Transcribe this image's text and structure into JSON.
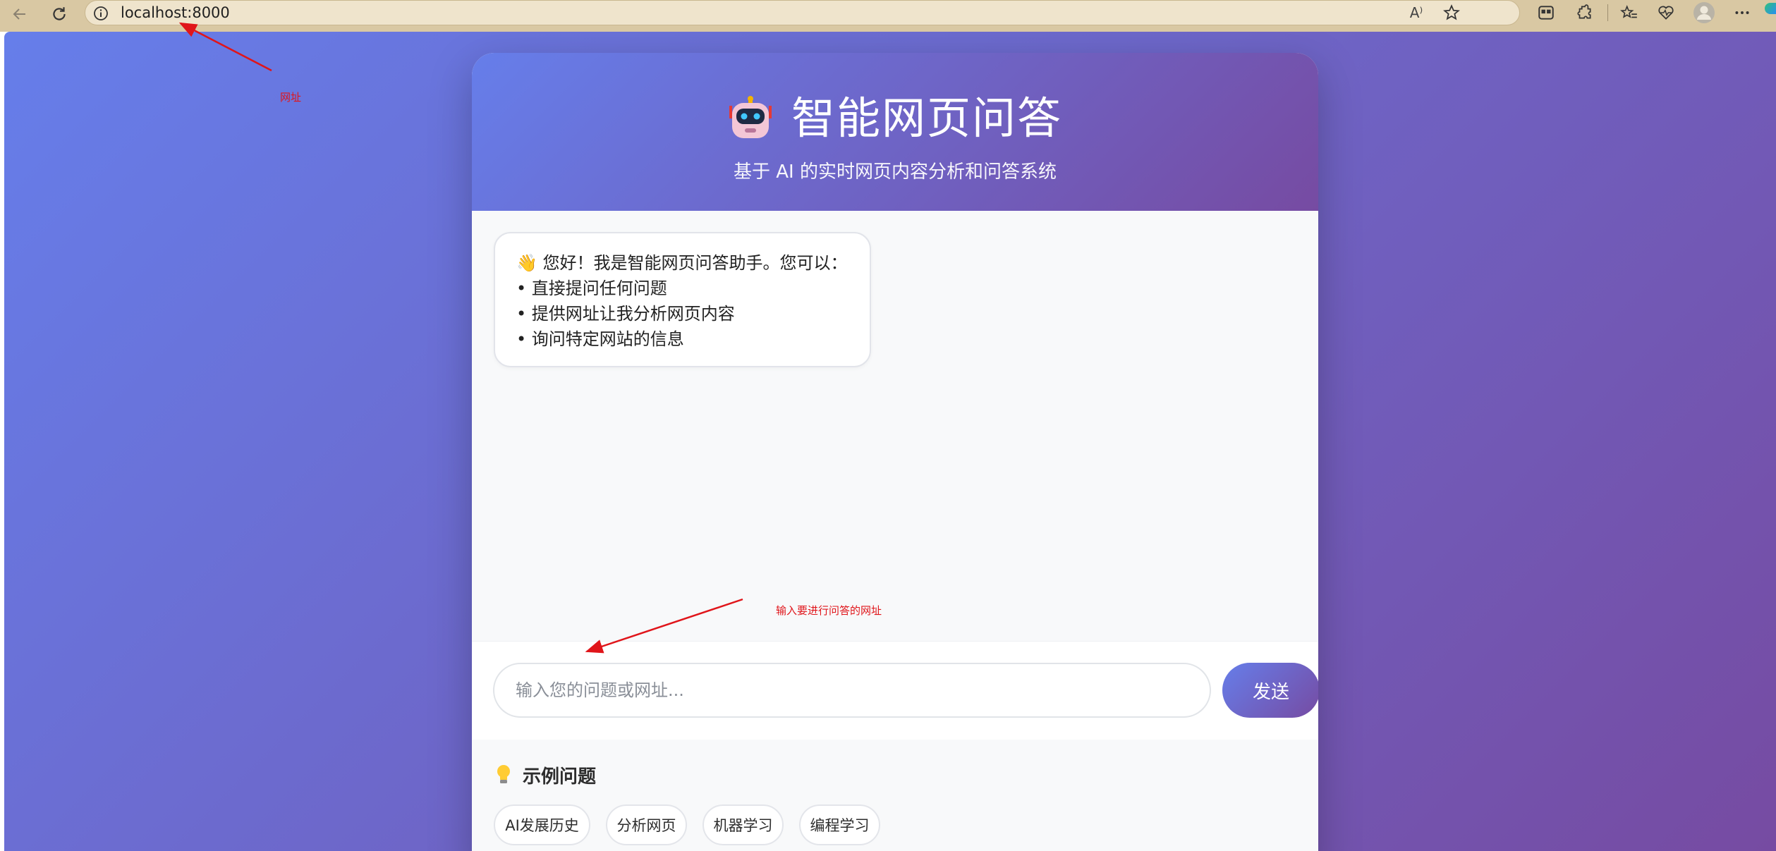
{
  "browser": {
    "url": "localhost:8000",
    "read_aloud_label": "A⁾"
  },
  "header": {
    "title": "智能网页问答",
    "subtitle": "基于 AI 的实时网页内容分析和问答系统"
  },
  "messages": [
    {
      "role": "bot",
      "lines": [
        "👋 您好！我是智能网页问答助手。您可以：",
        "• 直接提问任何问题",
        "• 提供网址让我分析网页内容",
        "• 询问特定网站的信息"
      ]
    }
  ],
  "input": {
    "placeholder": "输入您的问题或网址...",
    "value": ""
  },
  "send_button": {
    "label": "发送"
  },
  "examples": {
    "title": "示例问题",
    "items": [
      "AI发展历史",
      "分析网页",
      "机器学习",
      "编程学习"
    ]
  },
  "annotations": {
    "url_note": "网址",
    "input_note": "输入要进行问答的网址"
  },
  "colors": {
    "gradient_start": "#667eea",
    "gradient_end": "#764ba2",
    "annotation_red": "#e0151a"
  }
}
